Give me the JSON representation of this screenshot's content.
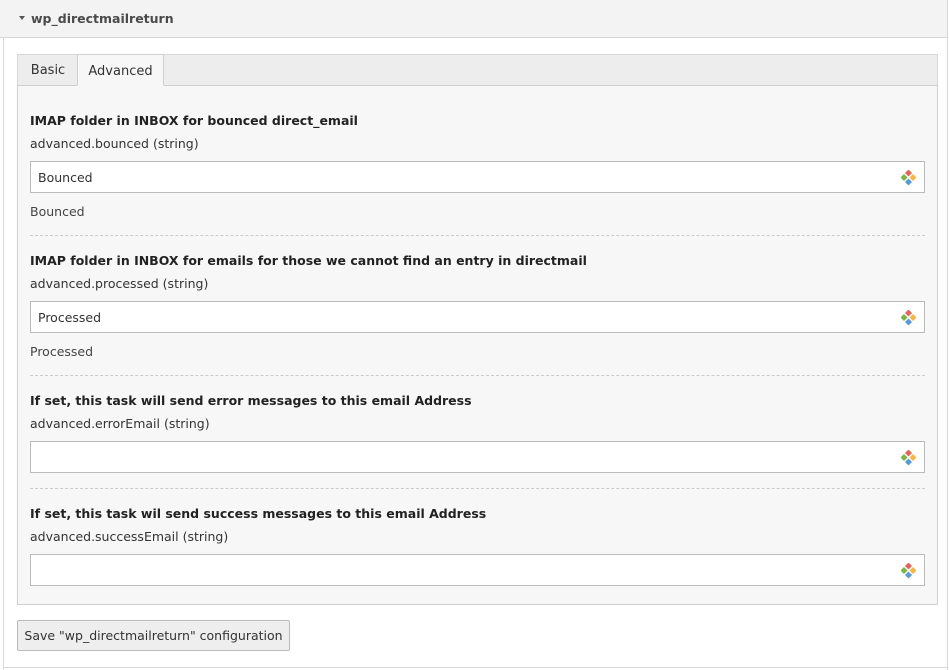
{
  "header": {
    "title": "wp_directmailreturn"
  },
  "tabs": [
    {
      "label": "Basic",
      "active": false
    },
    {
      "label": "Advanced",
      "active": true
    }
  ],
  "fields": [
    {
      "title": "IMAP folder in INBOX for bounced direct_email",
      "key": "advanced.bounced (string)",
      "value": "Bounced",
      "default": "Bounced"
    },
    {
      "title": "IMAP folder in INBOX for emails for those we cannot find an entry in directmail",
      "key": "advanced.processed (string)",
      "value": "Processed",
      "default": "Processed"
    },
    {
      "title": "If set, this task will send error messages to this email Address",
      "key": "advanced.errorEmail (string)",
      "value": "",
      "default": ""
    },
    {
      "title": "If set, this task wil send success messages to this email Address",
      "key": "advanced.successEmail (string)",
      "value": "",
      "default": ""
    }
  ],
  "save_button": {
    "label": "Save \"wp_directmailreturn\" configuration"
  },
  "icons": {
    "collapse": "caret-down-icon",
    "field_wizard": "field-wizard-icon"
  },
  "colors": {
    "header_bg": "#f3f3f3",
    "panel_bg": "#f7f7f7",
    "border": "#cfcfcf"
  }
}
